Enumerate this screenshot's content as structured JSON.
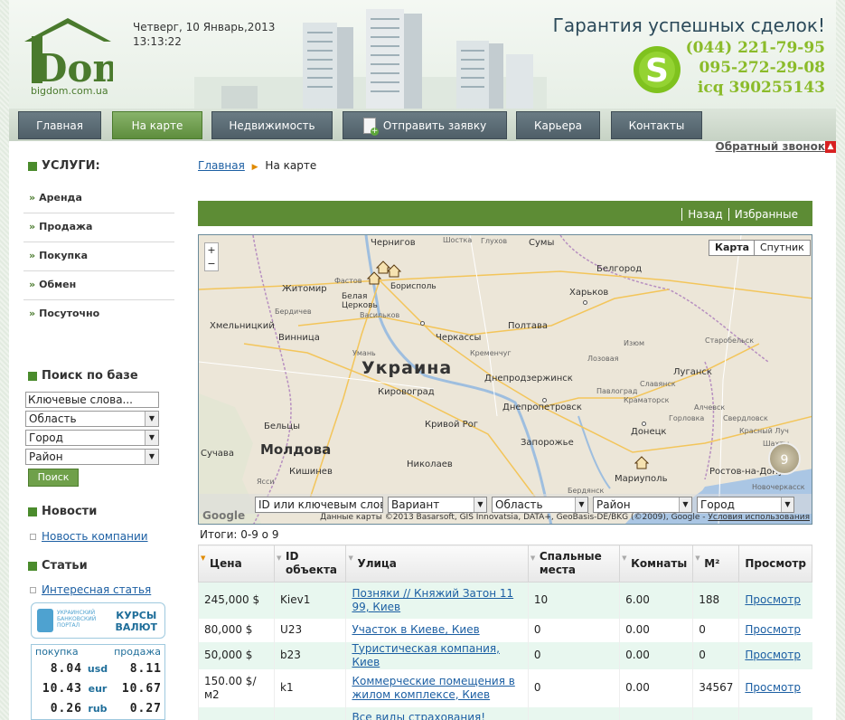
{
  "header": {
    "logo_text": "Dom",
    "site": "bigdom.com.ua",
    "date": "Четверг, 10 Январь,2013",
    "time": "13:13:22",
    "tagline": "Гарантия успешных сделок!",
    "phone1": "(044) 221-79-95",
    "phone2": "095-272-29-08",
    "icq": "icq 390255143",
    "colors": {
      "logo_green": "#4a7a2d",
      "phone_green": "#8bbb2a",
      "skype_green": "#7fc21e"
    }
  },
  "nav": {
    "items": [
      {
        "label": "Главная"
      },
      {
        "label": "На карте",
        "active": true
      },
      {
        "label": "Недвижимость"
      },
      {
        "label": "Отправить заявку",
        "icon": "document-add-icon"
      },
      {
        "label": "Карьера"
      },
      {
        "label": "Контакты"
      }
    ]
  },
  "callback": "Обратный звонок",
  "sidebar": {
    "services_title": "УСЛУГИ:",
    "services": [
      "Аренда",
      "Продажа",
      "Покупка",
      "Обмен",
      "Посуточно"
    ],
    "search_title": "Поиск по базе",
    "search_keywords": "Ключевые слова...",
    "search_region": "Область",
    "search_city": "Город",
    "search_district": "Район",
    "search_button": "Поиск",
    "news_title": "Новости",
    "news_link": "Новость компании",
    "articles_title": "Статьи",
    "articles_link": "Интересная статья",
    "rates_portal": "УКРАИНСКИЙ БАНКОВСКИЙ ПОРТАЛ",
    "rates_title_1": "КУРСЫ",
    "rates_title_2": "ВАЛЮТ",
    "rates_buy": "покупка",
    "rates_sell": "продажа",
    "rates": [
      {
        "cur": "usd",
        "buy": "8.04",
        "sell": "8.11"
      },
      {
        "cur": "eur",
        "buy": "10.43",
        "sell": "10.67"
      },
      {
        "cur": "rub",
        "buy": "0.26",
        "sell": "0.27"
      }
    ]
  },
  "breadcrumb": {
    "home": "Главная",
    "current": "На карте"
  },
  "toolbar": {
    "back": "Назад",
    "favorites": "Избранные"
  },
  "map": {
    "type_map": "Карта",
    "type_satellite": "Спутник",
    "country": "Украина",
    "moldova": "Молдова",
    "cluster_count": "9",
    "attribution": "Данные карты ©2013 Basarsoft, GIS Innovatsia, DATA+, GeoBasis-DE/BKG (©2009), Google -",
    "terms": "Условия использования",
    "google": "Google",
    "filter_id": "ID или ключевым словам",
    "filter_variant": "Вариант",
    "filter_region": "Область",
    "filter_district": "Район",
    "filter_city": "Город",
    "cities": [
      "Сумы",
      "Глухов",
      "Шостка",
      "Чернигов",
      "Белгород",
      "Житомир",
      "Белая Церковь",
      "Борисполь",
      "Харьков",
      "Хмельницкий",
      "Винница",
      "Полтава",
      "Черкассы",
      "Кировоград",
      "Днепродзержинск",
      "Днепропетровск",
      "Луганск",
      "Кривой Рог",
      "Запорожье",
      "Донецк",
      "Николаев",
      "Мариуполь",
      "Кишинев",
      "Бельцы",
      "Сучава",
      "Ростов-на-Дону",
      "Шахты",
      "Новочеркасск",
      "Свердловск",
      "Павлоград",
      "Изюм",
      "Кременчуг",
      "Умань",
      "Бердичев",
      "Фастов",
      "Васильков",
      "Лозовая",
      "Бердянск",
      "Ясси",
      "Краматорск",
      "Славянск",
      "Алчевск",
      "Горловка",
      "Старобельск",
      "Красный Луч"
    ]
  },
  "results": {
    "summary": "Итоги: 0-9 о 9",
    "columns": [
      "Цена",
      "ID объекта",
      "Улица",
      "Спальные места",
      "Комнаты",
      "М²",
      "Просмотр"
    ],
    "rows": [
      {
        "price": "245,000 $",
        "id": "Kiev1",
        "street": "Позняки // Княжий Затон 11 99, Киев",
        "beds": "10",
        "rooms": "6.00",
        "m2": "188",
        "view": "Просмотр"
      },
      {
        "price": "80,000 $",
        "id": "U23",
        "street": "Участок в Киеве, Киев",
        "beds": "0",
        "rooms": "0.00",
        "m2": "0",
        "view": "Просмотр"
      },
      {
        "price": "50,000 $",
        "id": "b23",
        "street": "Туристическая компания, Киев",
        "beds": "0",
        "rooms": "0.00",
        "m2": "0",
        "view": "Просмотр"
      },
      {
        "price": "150.00 $/м2",
        "id": "k1",
        "street": "Коммерческие помещения в жилом комплексе, Киев",
        "beds": "0",
        "rooms": "0.00",
        "m2": "34567",
        "view": "Просмотр"
      },
      {
        "price": "",
        "id": "",
        "street": "Все виды страхования!",
        "beds": "",
        "rooms": "",
        "m2": "",
        "view": ""
      }
    ]
  }
}
